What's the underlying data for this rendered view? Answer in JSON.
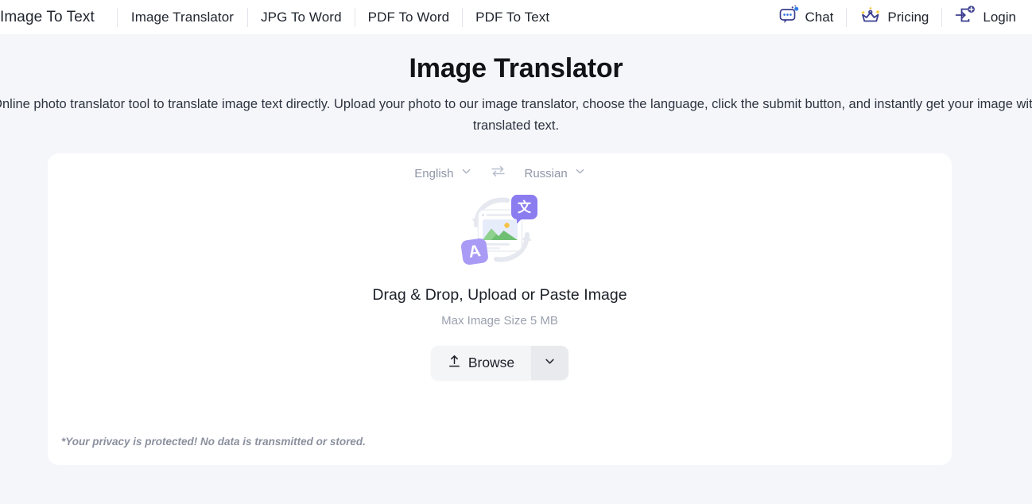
{
  "header": {
    "nav_left": [
      {
        "label": "Image To Text",
        "icon": ""
      },
      {
        "label": "Image Translator",
        "icon": ""
      },
      {
        "label": "JPG To Word",
        "icon": ""
      },
      {
        "label": "PDF To Word",
        "icon": ""
      },
      {
        "label": "PDF To Text",
        "icon": ""
      }
    ],
    "nav_right": [
      {
        "label": "Chat",
        "icon": "chat-bubble-icon"
      },
      {
        "label": "Pricing",
        "icon": "crown-icon"
      },
      {
        "label": "Login",
        "icon": "login-arrow-icon"
      }
    ]
  },
  "hero": {
    "title": "Image Translator",
    "description": "Online photo translator tool to translate image text directly. Upload your photo to our image translator, choose the language, click the submit button, and instantly get your image with translated text."
  },
  "card": {
    "language": {
      "source": "English",
      "target": "Russian",
      "swap_icon": "swap-arrows-icon",
      "chevron_icon": "chevron-down-icon"
    },
    "illustration": {
      "name": "image-translate-illustration",
      "badge_translate": "文",
      "badge_letter": "A"
    },
    "drop_title": "Drag & Drop, Upload or Paste Image",
    "drop_subtitle": "Max Image Size 5 MB",
    "browse_label": "Browse",
    "browse_icon": "upload-icon",
    "browse_caret_icon": "chevron-down-icon",
    "privacy_note": "*Your privacy is protected! No data is transmitted or stored."
  },
  "colors": {
    "page_bg": "#f5f6fa",
    "card_bg": "#ffffff",
    "accent_purple": "#8b7cf0",
    "accent_purple_light": "#a99bf5",
    "crown_blue": "#3b3f8f",
    "sparkle_yellow": "#f5c518",
    "muted_text": "#9aa0ae"
  }
}
